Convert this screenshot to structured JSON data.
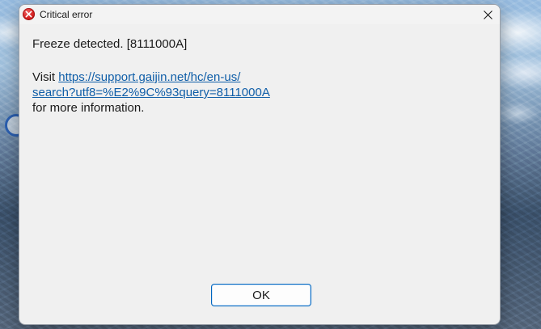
{
  "window": {
    "title": "Critical error",
    "icon": "error-icon",
    "close_icon": "close-icon"
  },
  "message": {
    "line1": "Freeze detected. [8111000A]",
    "visit_label": "Visit ",
    "link_part1": "https://support.gaijin.net/hc/en-us/",
    "link_part2": "search?utf8=%E2%9C%93query=8111000A",
    "footer": "for more information."
  },
  "buttons": {
    "ok_label": "OK"
  },
  "colors": {
    "link": "#0f5ea8",
    "error_icon": "#d61f1f",
    "ok_border": "#0067c0"
  }
}
